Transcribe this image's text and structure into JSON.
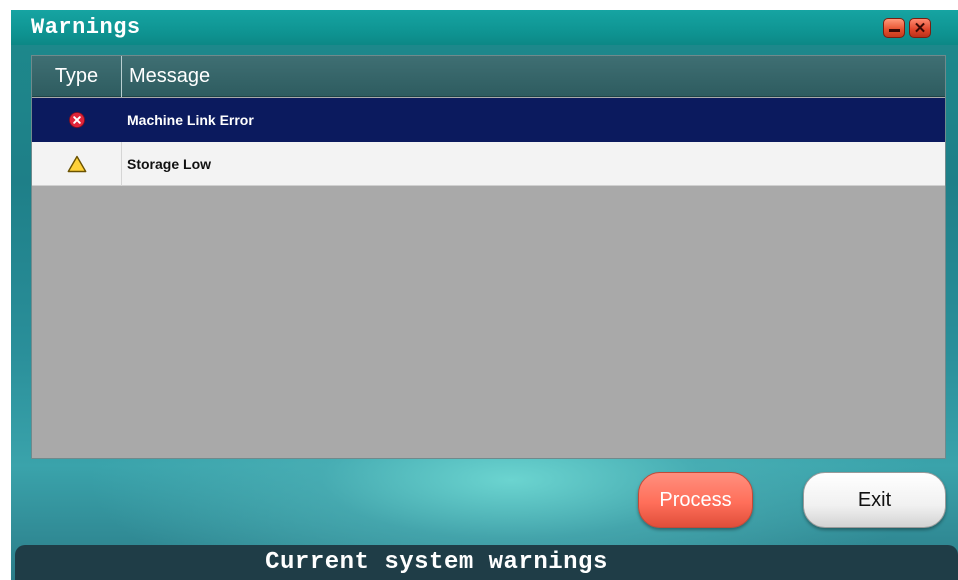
{
  "window": {
    "title": "Warnings"
  },
  "title_bar_buttons": {
    "minimize_icon": "minimize-icon",
    "close_icon": "close-icon"
  },
  "table": {
    "columns": [
      "Type",
      "Message"
    ],
    "rows": [
      {
        "type_icon": "error-icon",
        "message": "Machine Link Error",
        "selected": true
      },
      {
        "type_icon": "warning-icon",
        "message": "Storage Low",
        "selected": false
      }
    ]
  },
  "buttons": {
    "process_label": "Process",
    "exit_label": "Exit"
  },
  "status_bar": {
    "text": "Current system warnings"
  },
  "colors": {
    "selected_row": "#0b1a5e",
    "process_button": "#ff6f5a",
    "header": "#2e5c60"
  }
}
